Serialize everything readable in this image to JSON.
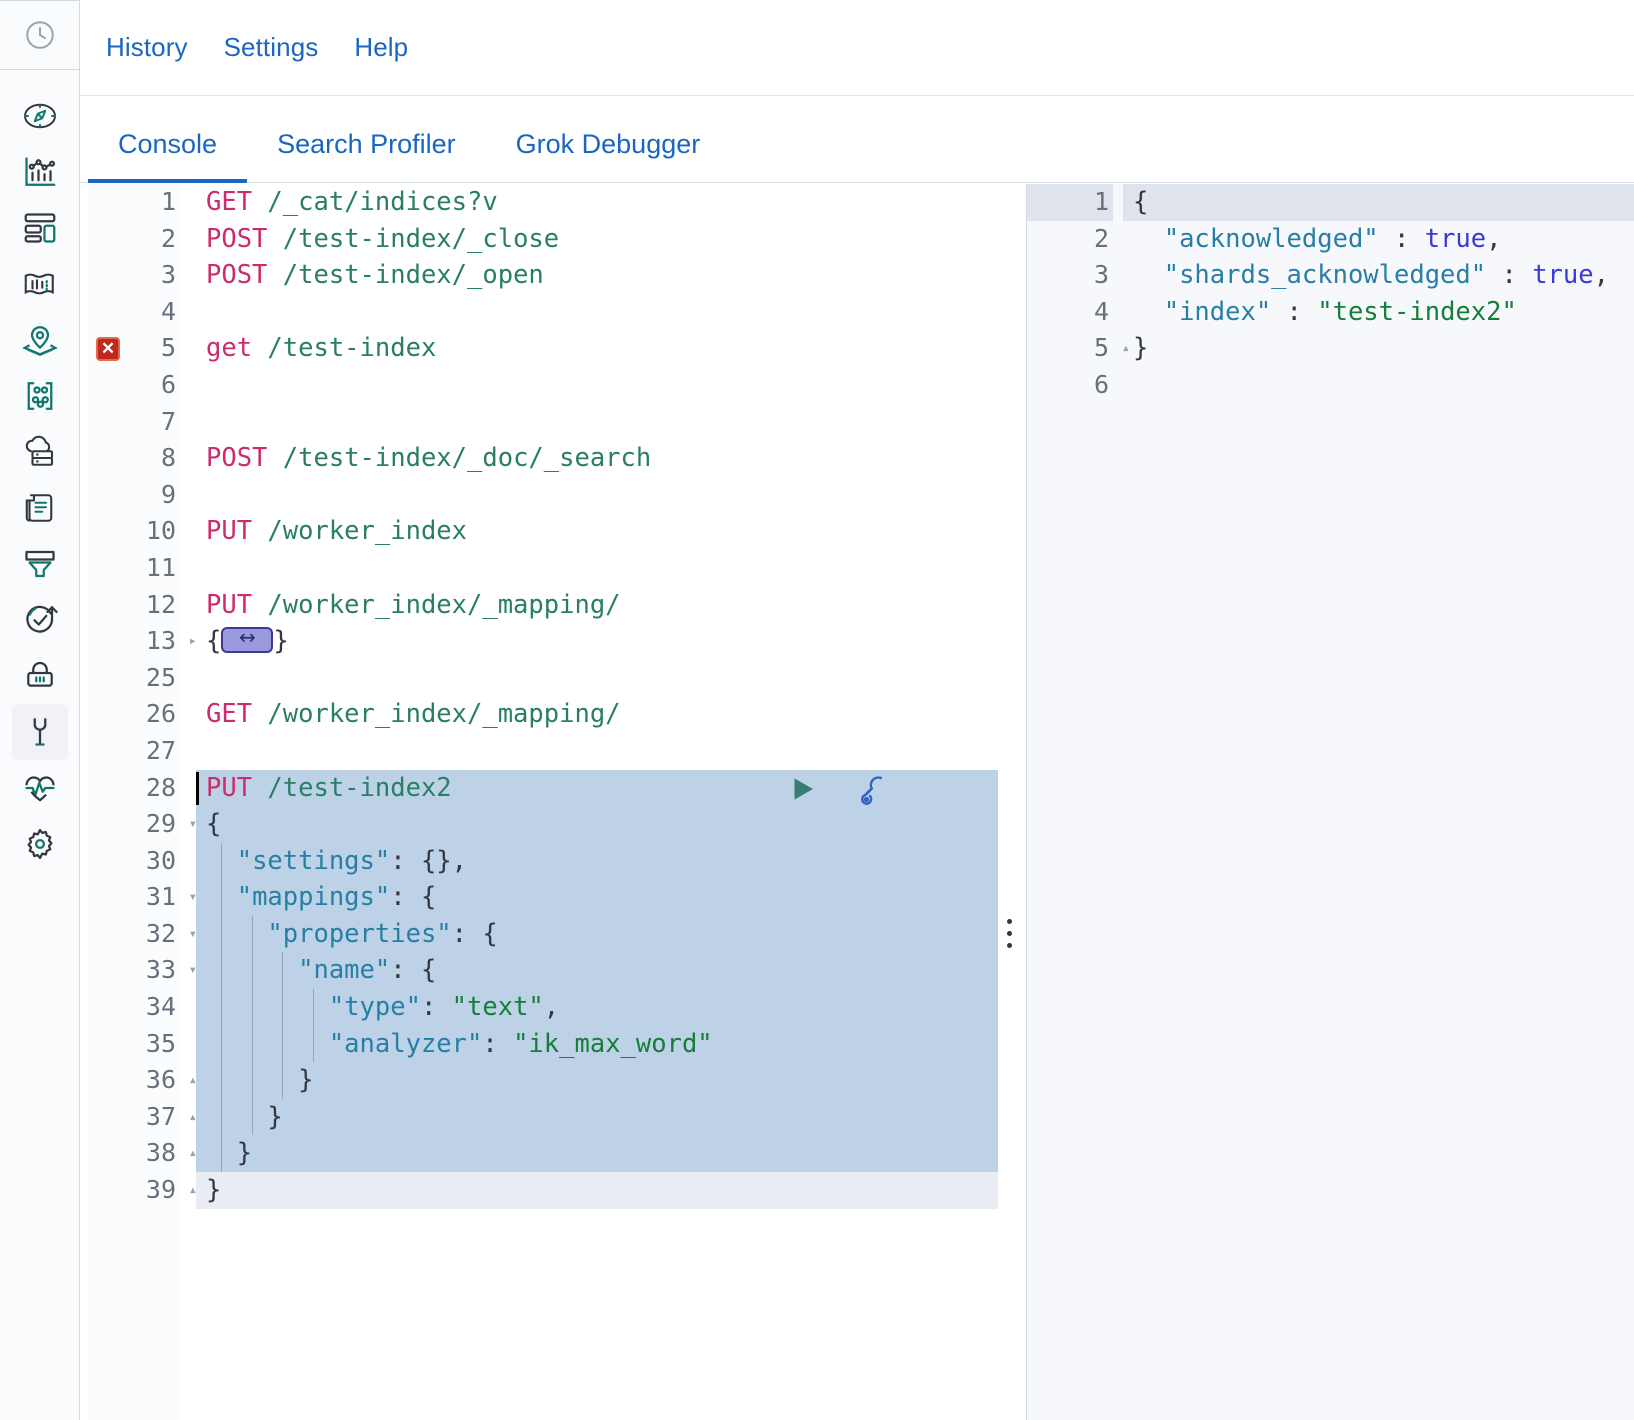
{
  "app": {
    "name": "Kibana Dev Tools Console"
  },
  "rail": {
    "icons": [
      {
        "name": "recently-viewed-icon",
        "glyph": "clock"
      },
      {
        "name": "discover-icon",
        "glyph": "compass"
      },
      {
        "name": "visualize-icon",
        "glyph": "chart"
      },
      {
        "name": "dashboard-icon",
        "glyph": "dashboard"
      },
      {
        "name": "canvas-icon",
        "glyph": "canvas"
      },
      {
        "name": "maps-icon",
        "glyph": "map-marker"
      },
      {
        "name": "machine-learning-icon",
        "glyph": "ml-dots"
      },
      {
        "name": "infrastructure-icon",
        "glyph": "cloud-server"
      },
      {
        "name": "logs-icon",
        "glyph": "scroll"
      },
      {
        "name": "apm-icon",
        "glyph": "apm-funnel"
      },
      {
        "name": "uptime-icon",
        "glyph": "uptime-check"
      },
      {
        "name": "security-icon",
        "glyph": "lock"
      },
      {
        "name": "dev-tools-icon",
        "glyph": "wrench"
      },
      {
        "name": "monitoring-icon",
        "glyph": "heartbeat"
      },
      {
        "name": "management-icon",
        "glyph": "gear"
      }
    ],
    "active_index": 12
  },
  "menubar": {
    "items": [
      {
        "label": "History",
        "name": "menu-history"
      },
      {
        "label": "Settings",
        "name": "menu-settings"
      },
      {
        "label": "Help",
        "name": "menu-help"
      }
    ]
  },
  "tabs": {
    "items": [
      {
        "label": "Console",
        "name": "tab-console",
        "selected": true
      },
      {
        "label": "Search Profiler",
        "name": "tab-search-profiler",
        "selected": false
      },
      {
        "label": "Grok Debugger",
        "name": "tab-grok-debugger",
        "selected": false
      }
    ]
  },
  "colors": {
    "accent": "#1a66c2",
    "method": "#cc2c6e",
    "url": "#2a7e66",
    "key": "#277fa6",
    "string": "#177d3b",
    "boolean": "#3a39d6",
    "selection": "#bdd2e6",
    "active_line": "#e9edf3",
    "error_marker": "#bd271e",
    "run_icon": "#357f71",
    "wrench_icon": "#3062c4"
  },
  "editor": {
    "name": "request-editor",
    "error_line": 5,
    "selected_lines": [
      28,
      29,
      30,
      31,
      32,
      33,
      34,
      35,
      36,
      37,
      38
    ],
    "active_line": 39,
    "cursor_line": 28,
    "run_button_label": "Click to send request",
    "wrench_button_label": "Open documentation / options",
    "lines": [
      {
        "num": "1",
        "fold": "",
        "tokens": [
          {
            "c": "k-method",
            "t": "GET"
          },
          {
            "c": "k-punct",
            "t": " "
          },
          {
            "c": "k-url",
            "t": "/_cat/indices?v"
          }
        ]
      },
      {
        "num": "2",
        "fold": "",
        "tokens": [
          {
            "c": "k-method",
            "t": "POST"
          },
          {
            "c": "k-punct",
            "t": " "
          },
          {
            "c": "k-url",
            "t": "/test-index/_close"
          }
        ]
      },
      {
        "num": "3",
        "fold": "",
        "tokens": [
          {
            "c": "k-method",
            "t": "POST"
          },
          {
            "c": "k-punct",
            "t": " "
          },
          {
            "c": "k-url",
            "t": "/test-index/_open"
          }
        ]
      },
      {
        "num": "4",
        "fold": "",
        "tokens": []
      },
      {
        "num": "5",
        "fold": "",
        "tokens": [
          {
            "c": "k-method",
            "t": "get"
          },
          {
            "c": "k-punct",
            "t": " "
          },
          {
            "c": "k-url",
            "t": "/test-index"
          }
        ]
      },
      {
        "num": "6",
        "fold": "",
        "tokens": []
      },
      {
        "num": "7",
        "fold": "",
        "tokens": []
      },
      {
        "num": "8",
        "fold": "",
        "tokens": [
          {
            "c": "k-method",
            "t": "POST"
          },
          {
            "c": "k-punct",
            "t": " "
          },
          {
            "c": "k-url",
            "t": "/test-index/_doc/_search"
          }
        ]
      },
      {
        "num": "9",
        "fold": "",
        "tokens": []
      },
      {
        "num": "10",
        "fold": "",
        "tokens": [
          {
            "c": "k-method",
            "t": "PUT"
          },
          {
            "c": "k-punct",
            "t": " "
          },
          {
            "c": "k-url",
            "t": "/worker_index"
          }
        ]
      },
      {
        "num": "11",
        "fold": "",
        "tokens": []
      },
      {
        "num": "12",
        "fold": "",
        "tokens": [
          {
            "c": "k-method",
            "t": "PUT"
          },
          {
            "c": "k-punct",
            "t": " "
          },
          {
            "c": "k-url",
            "t": "/worker_index/_mapping/"
          }
        ]
      },
      {
        "num": "13",
        "fold": "closed",
        "folded": true,
        "tokens": [
          {
            "c": "k-punct",
            "t": "{"
          },
          {
            "c": "fold-widget",
            "t": "↔"
          },
          {
            "c": "k-punct",
            "t": "}"
          }
        ]
      },
      {
        "num": "25",
        "fold": "",
        "tokens": []
      },
      {
        "num": "26",
        "fold": "",
        "tokens": [
          {
            "c": "k-method",
            "t": "GET"
          },
          {
            "c": "k-punct",
            "t": " "
          },
          {
            "c": "k-url",
            "t": "/worker_index/_mapping/"
          }
        ]
      },
      {
        "num": "27",
        "fold": "",
        "tokens": []
      },
      {
        "num": "28",
        "fold": "",
        "tokens": [
          {
            "c": "k-method",
            "t": "PUT"
          },
          {
            "c": "k-punct",
            "t": " "
          },
          {
            "c": "k-url",
            "t": "/test-index2"
          }
        ]
      },
      {
        "num": "29",
        "fold": "open",
        "tokens": [
          {
            "c": "k-punct",
            "t": "{"
          }
        ]
      },
      {
        "num": "30",
        "fold": "",
        "indent": 0,
        "tokens": [
          {
            "c": "k-punct",
            "t": "  "
          },
          {
            "c": "k-key",
            "t": "\"settings\""
          },
          {
            "c": "k-punct",
            "t": ": {},"
          }
        ]
      },
      {
        "num": "31",
        "fold": "open",
        "indent": 0,
        "tokens": [
          {
            "c": "k-punct",
            "t": "  "
          },
          {
            "c": "k-key",
            "t": "\"mappings\""
          },
          {
            "c": "k-punct",
            "t": ": {"
          }
        ]
      },
      {
        "num": "32",
        "fold": "open",
        "indent": 1,
        "tokens": [
          {
            "c": "k-punct",
            "t": "    "
          },
          {
            "c": "k-key",
            "t": "\"properties\""
          },
          {
            "c": "k-punct",
            "t": ": {"
          }
        ]
      },
      {
        "num": "33",
        "fold": "open",
        "indent": 2,
        "tokens": [
          {
            "c": "k-punct",
            "t": "      "
          },
          {
            "c": "k-key",
            "t": "\"name\""
          },
          {
            "c": "k-punct",
            "t": ": {"
          }
        ]
      },
      {
        "num": "34",
        "fold": "",
        "indent": 3,
        "tokens": [
          {
            "c": "k-punct",
            "t": "        "
          },
          {
            "c": "k-key",
            "t": "\"type\""
          },
          {
            "c": "k-punct",
            "t": ": "
          },
          {
            "c": "k-str",
            "t": "\"text\""
          },
          {
            "c": "k-punct",
            "t": ","
          }
        ]
      },
      {
        "num": "35",
        "fold": "",
        "indent": 3,
        "tokens": [
          {
            "c": "k-punct",
            "t": "        "
          },
          {
            "c": "k-key",
            "t": "\"analyzer\""
          },
          {
            "c": "k-punct",
            "t": ": "
          },
          {
            "c": "k-str",
            "t": "\"ik_max_word\""
          }
        ]
      },
      {
        "num": "36",
        "fold": "close",
        "indent": 2,
        "tokens": [
          {
            "c": "k-punct",
            "t": "      }"
          }
        ]
      },
      {
        "num": "37",
        "fold": "close",
        "indent": 1,
        "tokens": [
          {
            "c": "k-punct",
            "t": "    }"
          }
        ]
      },
      {
        "num": "38",
        "fold": "close",
        "indent": 0,
        "tokens": [
          {
            "c": "k-punct",
            "t": "  }"
          }
        ]
      },
      {
        "num": "39",
        "fold": "close",
        "tokens": [
          {
            "c": "k-punct",
            "t": "}"
          }
        ]
      }
    ]
  },
  "response": {
    "name": "response-viewer",
    "highlight_line": 1,
    "lines": [
      {
        "num": "1",
        "fold": "open",
        "tokens": [
          {
            "c": "k-punct",
            "t": "{"
          }
        ]
      },
      {
        "num": "2",
        "fold": "",
        "tokens": [
          {
            "c": "k-punct",
            "t": "  "
          },
          {
            "c": "k-key",
            "t": "\"acknowledged\""
          },
          {
            "c": "k-punct",
            "t": " : "
          },
          {
            "c": "k-bool",
            "t": "true"
          },
          {
            "c": "k-punct",
            "t": ","
          }
        ]
      },
      {
        "num": "3",
        "fold": "",
        "tokens": [
          {
            "c": "k-punct",
            "t": "  "
          },
          {
            "c": "k-key",
            "t": "\"shards_acknowledged\""
          },
          {
            "c": "k-punct",
            "t": " : "
          },
          {
            "c": "k-bool",
            "t": "true"
          },
          {
            "c": "k-punct",
            "t": ","
          }
        ]
      },
      {
        "num": "4",
        "fold": "",
        "tokens": [
          {
            "c": "k-punct",
            "t": "  "
          },
          {
            "c": "k-key",
            "t": "\"index\""
          },
          {
            "c": "k-punct",
            "t": " : "
          },
          {
            "c": "k-str",
            "t": "\"test-index2\""
          }
        ]
      },
      {
        "num": "5",
        "fold": "close",
        "tokens": [
          {
            "c": "k-punct",
            "t": "}"
          }
        ]
      },
      {
        "num": "6",
        "fold": "",
        "tokens": []
      }
    ]
  }
}
